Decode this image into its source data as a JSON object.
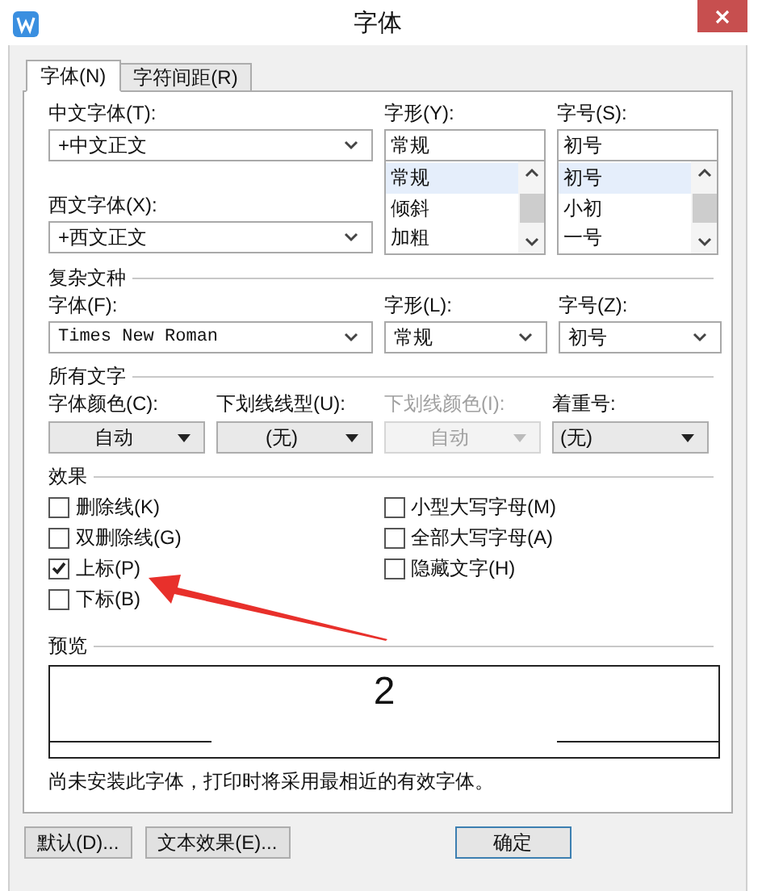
{
  "window": {
    "title": "字体"
  },
  "tabs": [
    {
      "label": "字体(N)",
      "selected": true
    },
    {
      "label": "字符间距(R)",
      "selected": false
    }
  ],
  "chinese_font": {
    "label": "中文字体(T):",
    "value": "+中文正文"
  },
  "western_font": {
    "label": "西文字体(X):",
    "value": "+西文正文"
  },
  "style": {
    "label": "字形(Y):",
    "value": "常规",
    "options": [
      {
        "label": "常规",
        "selected": true
      },
      {
        "label": "倾斜",
        "selected": false
      },
      {
        "label": "加粗",
        "selected": false
      }
    ]
  },
  "size": {
    "label": "字号(S):",
    "value": "初号",
    "options": [
      {
        "label": "初号",
        "selected": true
      },
      {
        "label": "小初",
        "selected": false
      },
      {
        "label": "一号",
        "selected": false
      }
    ]
  },
  "complex_script": {
    "title": "复杂文种",
    "fields": [
      {
        "label": "字体(F):",
        "value": "Times New Roman",
        "kind": "wide"
      },
      {
        "label": "字形(L):",
        "value": "常规",
        "kind": "narrow"
      },
      {
        "label": "字号(Z):",
        "value": "初号",
        "kind": "narrow"
      }
    ]
  },
  "all_text": {
    "title": "所有文字",
    "fields": [
      {
        "label": "字体颜色(C):",
        "value": "自动",
        "disabled": false,
        "kind": "centered"
      },
      {
        "label": "下划线线型(U):",
        "value": "(无)",
        "disabled": false,
        "kind": "centered"
      },
      {
        "label": "下划线颜色(I):",
        "value": "自动",
        "disabled": true,
        "kind": "centered"
      },
      {
        "label": "着重号:",
        "value": "(无)",
        "disabled": false,
        "kind": "left"
      }
    ]
  },
  "effects": {
    "title": "效果",
    "columns": [
      [
        {
          "label": "删除线(K)",
          "checked": false
        },
        {
          "label": "双删除线(G)",
          "checked": false
        },
        {
          "label": "上标(P)",
          "checked": true
        },
        {
          "label": "下标(B)",
          "checked": false
        }
      ],
      [
        {
          "label": "小型大写字母(M)",
          "checked": false
        },
        {
          "label": "全部大写字母(A)",
          "checked": false
        },
        {
          "label": "隐藏文字(H)",
          "checked": false
        }
      ]
    ]
  },
  "preview": {
    "title": "预览",
    "sample": "2",
    "note": "尚未安装此字体，打印时将采用最相近的有效字体。"
  },
  "buttons": [
    "默认(D)...",
    "文本效果(E)...",
    "确定"
  ]
}
